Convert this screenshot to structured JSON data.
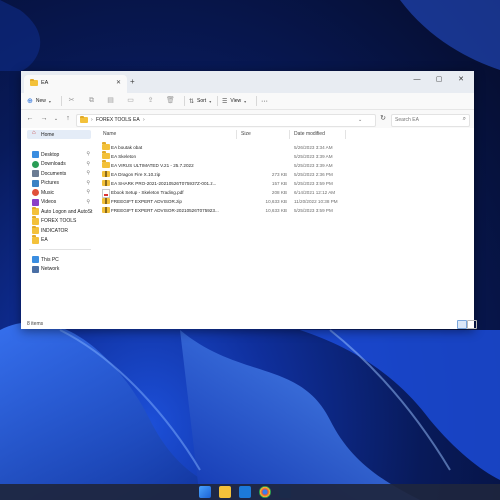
{
  "window": {
    "tab_title": "EA",
    "new_tab_symbol": "+",
    "controls": {
      "minimize": "—",
      "maximize": "▢",
      "close": "✕"
    }
  },
  "toolbar": {
    "new_label": "New",
    "sort_label": "Sort",
    "view_label": "View",
    "more_label": "···"
  },
  "address": {
    "crumbs": [
      "FOREX TOOLS",
      "EA"
    ],
    "search_placeholder": "Search EA"
  },
  "nav": {
    "home": "Home",
    "quick_access": [
      "Desktop",
      "Downloads",
      "Documents",
      "Pictures",
      "Music",
      "Videos"
    ],
    "folders": [
      "Auto Logon and AutoSt",
      "FOREX TOOLS",
      "INDICATOR",
      "EA"
    ],
    "this_pc": "This PC",
    "network": "Network"
  },
  "columns": {
    "name": "Name",
    "size": "Size",
    "date": "Date modified"
  },
  "files": [
    {
      "name": "EA boutak obat",
      "date": "5/26/2023 3:34 AM",
      "size": "",
      "icon": "folder"
    },
    {
      "name": "EA Skeleton",
      "date": "5/25/2023 3:39 AM",
      "size": "",
      "icon": "folder"
    },
    {
      "name": "EA VIRUS ULTIMATED V.21 - 25.7.2022",
      "date": "5/25/2023 3:39 AM",
      "size": "",
      "icon": "folder"
    },
    {
      "name": "EA Dragon Fire X.10.zip",
      "date": "5/25/2023 2:36 PM",
      "size": "273 KB",
      "icon": "zip"
    },
    {
      "name": "EA SHARK PRO-2021-20210526T075937Z-001.z...",
      "date": "5/25/2023 3:59 PM",
      "size": "157 KB",
      "icon": "zip"
    },
    {
      "name": "Ebook Setup - Skeleton Trading.pdf",
      "date": "6/14/2021 12:12 AM",
      "size": "208 KB",
      "icon": "pdf"
    },
    {
      "name": "FREEGIFT EXPERT ADVISOR.zip",
      "date": "11/20/2022 10:38 PM",
      "size": "10,633 KB",
      "icon": "zip"
    },
    {
      "name": "FREEGIFT EXPERT ADVISOR-20210526T075923...",
      "date": "5/25/2023 3:59 PM",
      "size": "10,633 KB",
      "icon": "zip"
    }
  ],
  "status": {
    "count": "8 items"
  }
}
